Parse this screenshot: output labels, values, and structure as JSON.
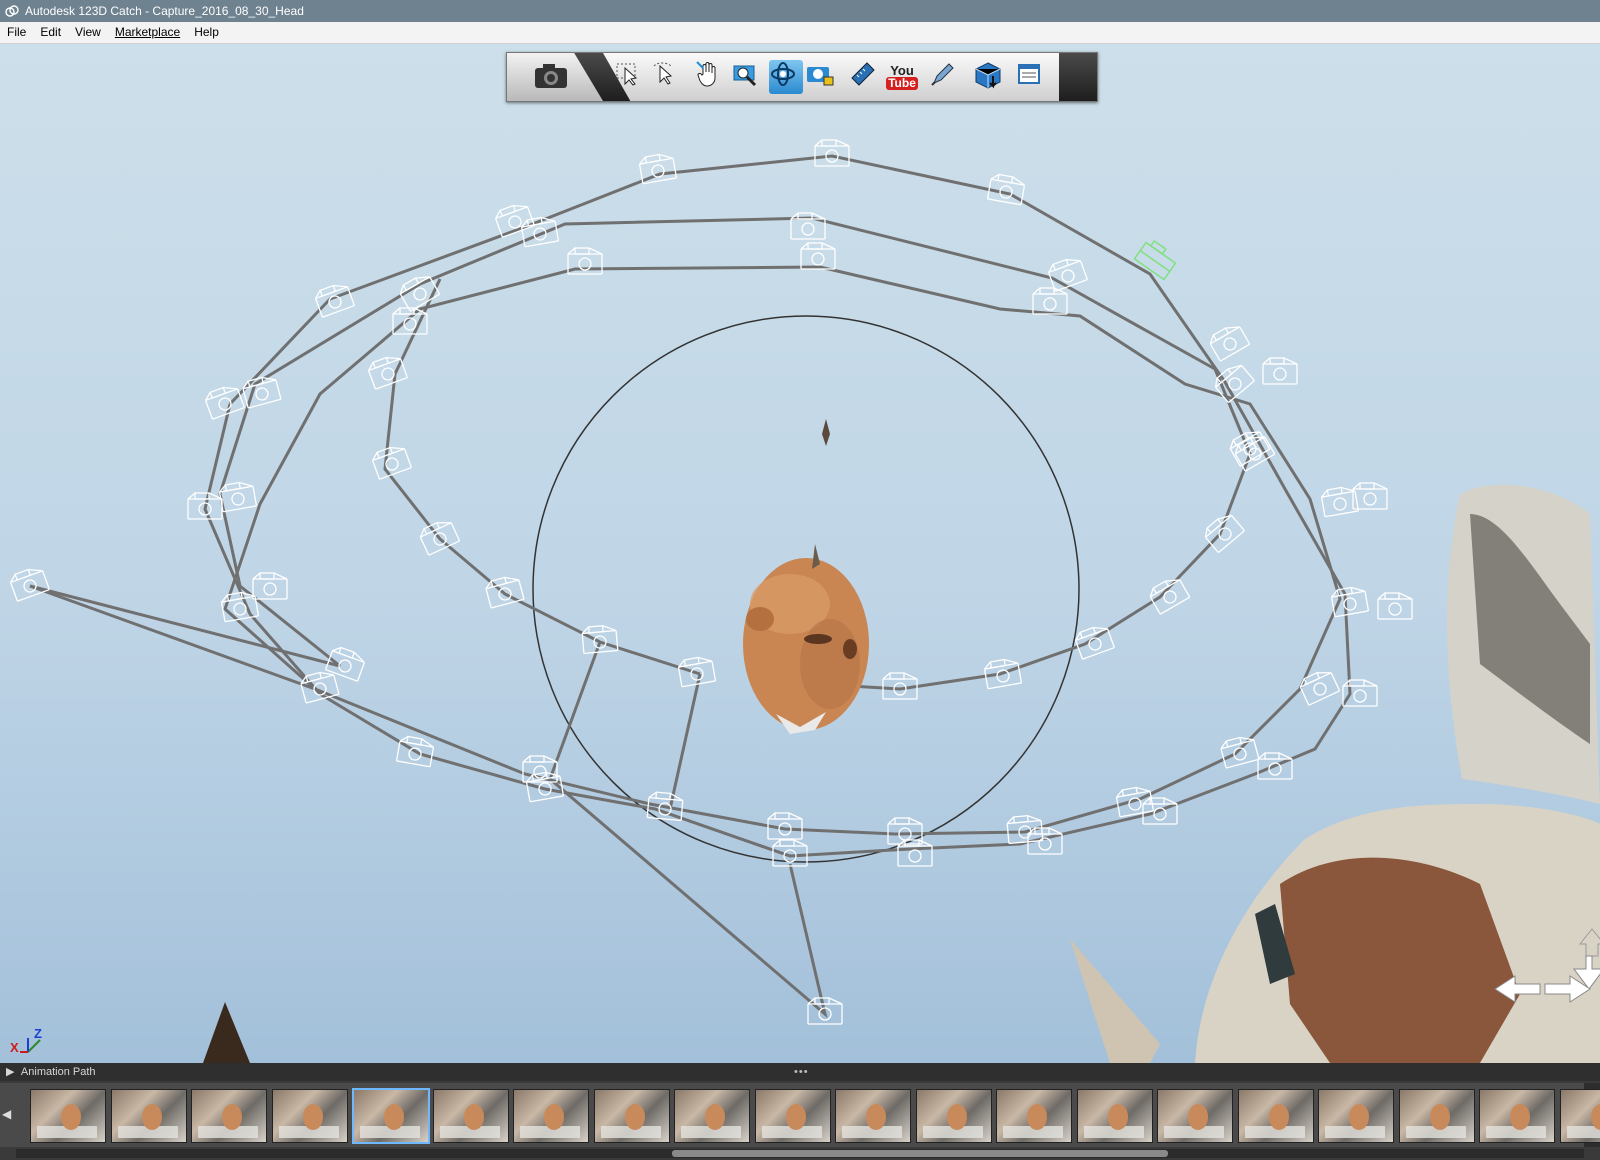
{
  "window": {
    "title": "Autodesk 123D Catch - Capture_2016_08_30_Head"
  },
  "menu": [
    "File",
    "Edit",
    "View",
    "Marketplace",
    "Help"
  ],
  "toolbar": {
    "buttons": [
      {
        "name": "capture-camera-button",
        "icon": "camera-icon"
      },
      {
        "name": "select-button",
        "icon": "arrow-select-icon"
      },
      {
        "name": "lasso-select-button",
        "icon": "lasso-select-icon"
      },
      {
        "name": "pan-button",
        "icon": "hand-pan-icon"
      },
      {
        "name": "zoom-window-button",
        "icon": "zoom-window-icon"
      },
      {
        "name": "orbit-button",
        "icon": "orbit-icon",
        "active": true
      },
      {
        "name": "camera-lock-button",
        "icon": "camera-lock-icon"
      },
      {
        "name": "reference-point-button",
        "icon": "ruler-icon"
      },
      {
        "name": "youtube-button",
        "icon": "youtube-icon"
      },
      {
        "name": "export-button",
        "icon": "pen-icon"
      },
      {
        "name": "render-button",
        "icon": "cube-grid-icon"
      },
      {
        "name": "properties-button",
        "icon": "properties-panel-icon"
      }
    ]
  },
  "youtube": {
    "top": "You",
    "bottom": "Tube"
  },
  "axes": {
    "x": "X",
    "z": "Z"
  },
  "animation_path": {
    "label": "Animation Path"
  },
  "filmstrip": {
    "count": 20,
    "selected_index": 4
  },
  "colors": {
    "camera_outline": "#ffffff",
    "camera_path": "#777777",
    "active_camera": "#7fe07f",
    "accent": "#2b8ad0"
  }
}
